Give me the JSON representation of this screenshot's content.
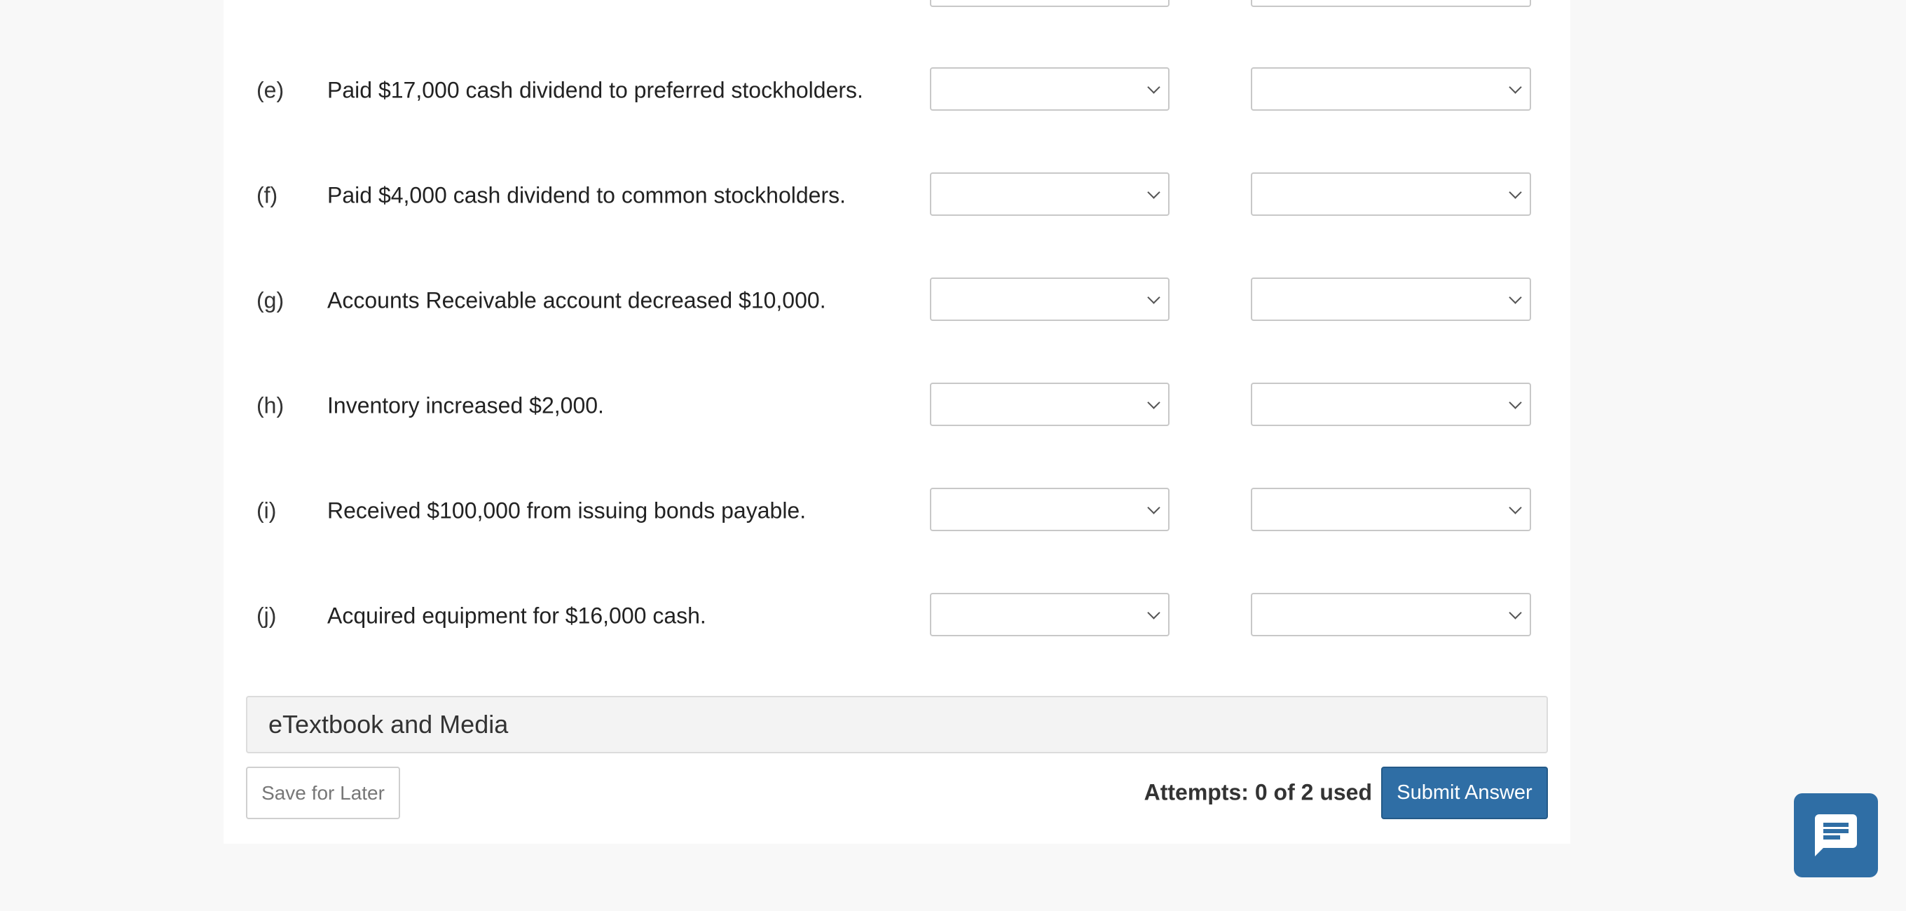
{
  "rows": [
    {
      "letter": "",
      "text": "",
      "col1": "",
      "col2": ""
    },
    {
      "letter": "(e)",
      "text": "Paid $17,000 cash dividend to preferred stockholders.",
      "col1": "",
      "col2": ""
    },
    {
      "letter": "(f)",
      "text": "Paid $4,000 cash dividend to common stockholders.",
      "col1": "",
      "col2": ""
    },
    {
      "letter": "(g)",
      "text": "Accounts Receivable account decreased $10,000.",
      "col1": "",
      "col2": ""
    },
    {
      "letter": "(h)",
      "text": "Inventory increased $2,000.",
      "col1": "",
      "col2": ""
    },
    {
      "letter": "(i)",
      "text": "Received $100,000 from issuing bonds payable.",
      "col1": "",
      "col2": ""
    },
    {
      "letter": "(j)",
      "text": "Acquired equipment for $16,000 cash.",
      "col1": "",
      "col2": ""
    }
  ],
  "etextbook": {
    "label": "eTextbook and Media"
  },
  "footer": {
    "save_label": "Save for Later",
    "attempts": "Attempts: 0 of 2 used",
    "submit_label": "Submit Answer"
  },
  "icons": {
    "chevron": "chevron-down-icon",
    "chat": "chat-bubble-icon"
  },
  "colors": {
    "accent": "#2f6ea5",
    "page_bg": "#f8f8f8",
    "panel_bg": "#ffffff"
  }
}
